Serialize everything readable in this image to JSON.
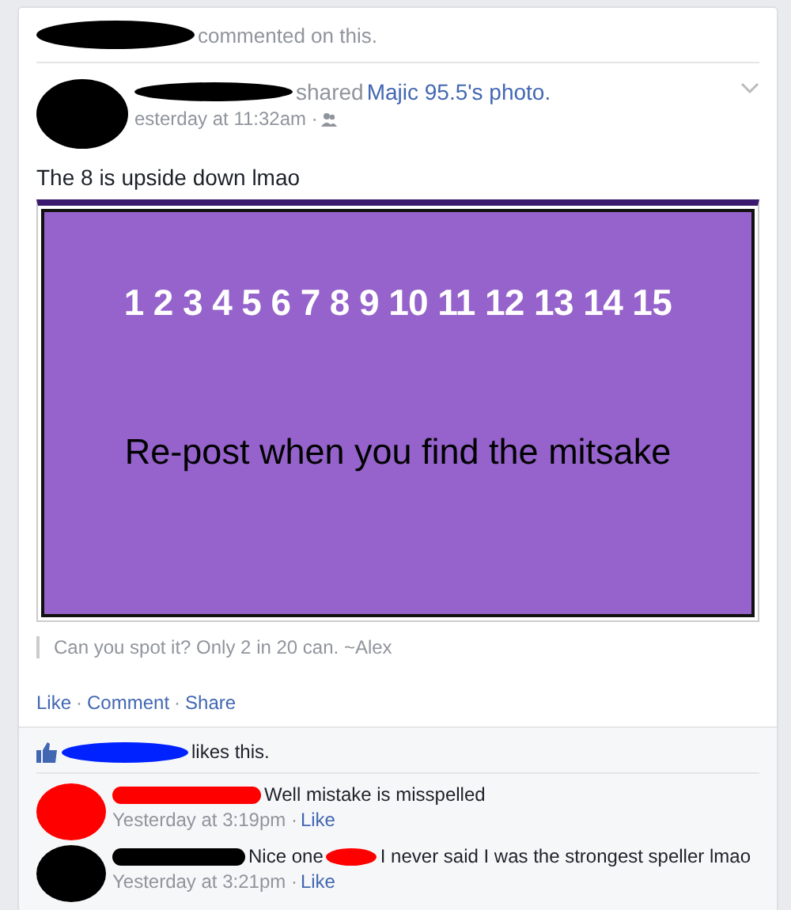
{
  "activity": {
    "text": "commented on this."
  },
  "post": {
    "shared_text": "shared",
    "page_link": "Majic 95.5's photo.",
    "time": "esterday at 11:32am ·",
    "message": "The 8 is upside down lmao",
    "image": {
      "numbers": "1 2 3 4 5 6 7 8 9 10 11 12 13 14 15",
      "slogan": "Re-post when you find the mitsake"
    },
    "caption": "Can you spot it? Only 2 in 20 can. ~Alex",
    "actions": [
      "Like",
      "Comment",
      "Share"
    ],
    "separator": "·"
  },
  "likes": {
    "text": "likes this."
  },
  "comments": [
    {
      "color": "#ff0000",
      "text": "Well mistake is misspelled",
      "time": "Yesterday at 3:19pm ·",
      "like": "Like"
    },
    {
      "color": "#000000",
      "text": "Nice one",
      "text_after": "I never said I was the strongest speller lmao",
      "time": "Yesterday at 3:21pm ·",
      "like": "Like"
    }
  ]
}
